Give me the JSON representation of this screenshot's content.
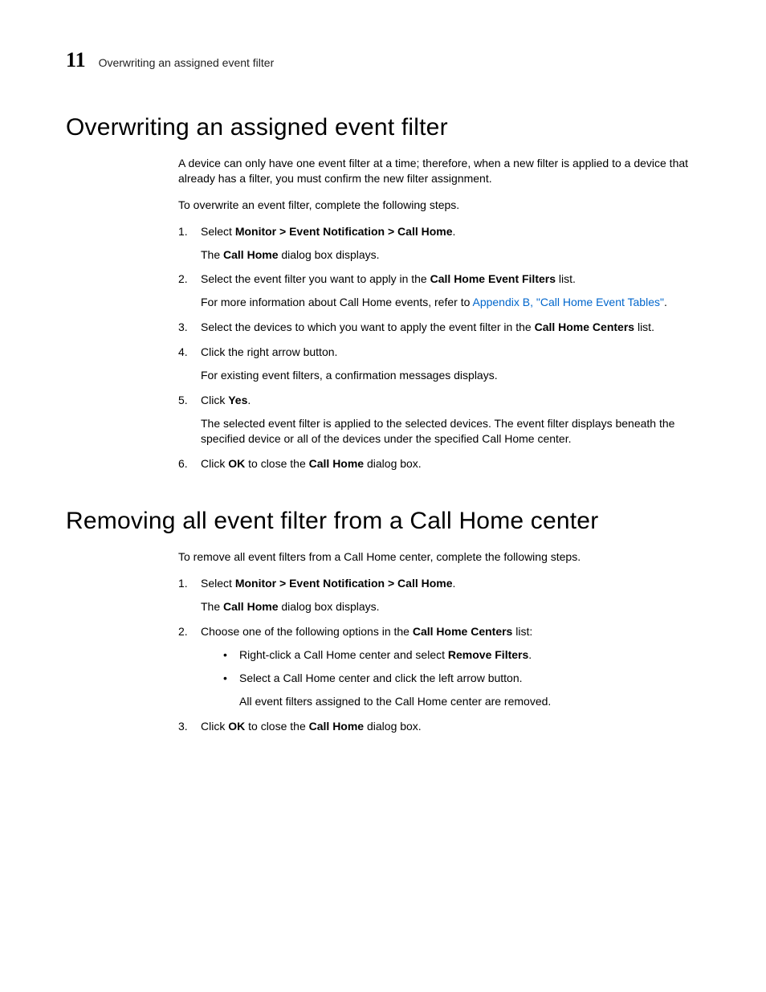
{
  "header": {
    "chapter_number": "11",
    "running_title": "Overwriting an assigned event filter"
  },
  "section1": {
    "heading": "Overwriting an assigned event filter",
    "intro1": "A device can only have one event filter at a time; therefore, when a new filter is applied to a device that already has a filter, you must confirm the new filter assignment.",
    "intro2": "To overwrite an event filter, complete the following steps.",
    "step1": {
      "pre": "Select ",
      "bold": "Monitor > Event Notification > Call Home",
      "post": "."
    },
    "step1_sub": {
      "pre": "The ",
      "bold": "Call Home",
      "post": " dialog box displays."
    },
    "step2": {
      "pre": "Select the event filter you want to apply in the ",
      "bold": "Call Home Event Filters",
      "post": " list."
    },
    "step2_sub": {
      "pre": "For more information about Call Home events, refer to ",
      "link": "Appendix B, \"Call Home Event Tables\"",
      "post": "."
    },
    "step3": {
      "pre": "Select the devices to which you want to apply the event filter in the ",
      "bold": "Call Home Centers",
      "post": " list."
    },
    "step4": "Click the right arrow button.",
    "step4_sub": "For existing event filters, a confirmation messages displays.",
    "step5": {
      "pre": "Click ",
      "bold": "Yes",
      "post": "."
    },
    "step5_sub": "The selected event filter is applied to the selected devices. The event filter displays beneath the specified device or all of the devices under the specified Call Home center.",
    "step6": {
      "pre": "Click ",
      "bold1": "OK",
      "mid": " to close the ",
      "bold2": "Call Home",
      "post": " dialog box."
    }
  },
  "section2": {
    "heading": "Removing all event filter from a Call Home center",
    "intro": "To remove all event filters from a Call Home center, complete the following steps.",
    "step1": {
      "pre": "Select ",
      "bold": "Monitor > Event Notification > Call Home",
      "post": "."
    },
    "step1_sub": {
      "pre": "The ",
      "bold": "Call Home",
      "post": " dialog box displays."
    },
    "step2": {
      "pre": "Choose one of the following options in the ",
      "bold": "Call Home Centers",
      "post": " list:"
    },
    "step2_b1": {
      "pre": "Right-click a Call Home center and select ",
      "bold": "Remove Filters",
      "post": "."
    },
    "step2_b2": "Select a Call Home center and click the left arrow button.",
    "step2_b2_sub": "All event filters assigned to the Call Home center are removed.",
    "step3": {
      "pre": "Click ",
      "bold1": "OK",
      "mid": " to close the ",
      "bold2": "Call Home",
      "post": " dialog box."
    }
  }
}
